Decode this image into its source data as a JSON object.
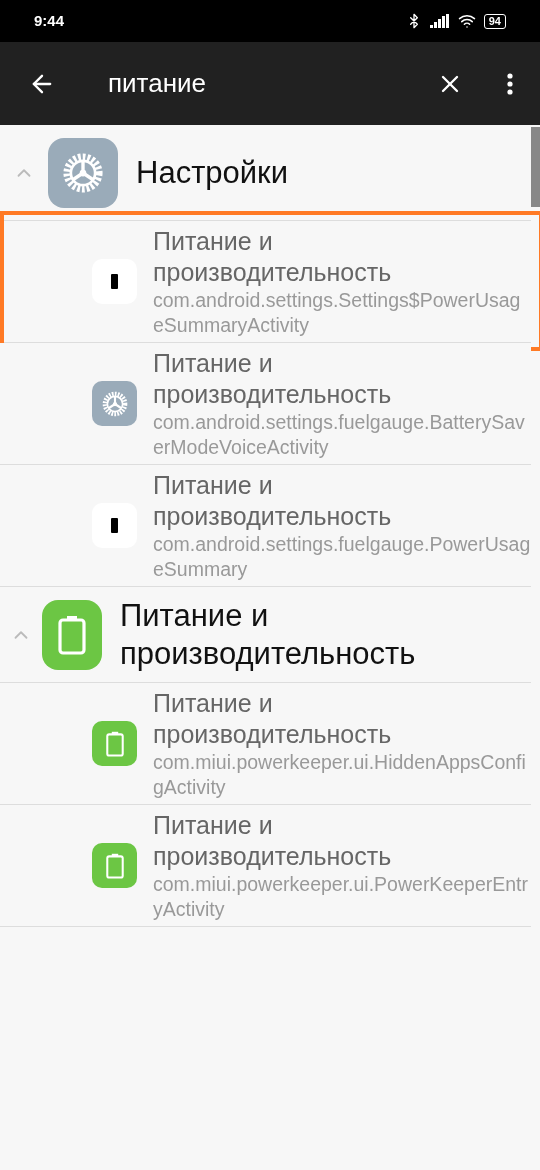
{
  "status_bar": {
    "time": "9:44",
    "battery": "94"
  },
  "toolbar": {
    "query": "питание"
  },
  "groups": [
    {
      "title": "Настройки",
      "kind": "gear",
      "expanded": true,
      "items": [
        {
          "title": "Питание и производительность",
          "subtitle": "com.android.settings.Settings$PowerUsageSummaryActivity",
          "kind": "battery-white",
          "highlighted": true
        },
        {
          "title": "Питание и производительность",
          "subtitle": "com.android.settings.fuelgauge.BatterySaverModeVoiceActivity",
          "kind": "gear",
          "highlighted": false
        },
        {
          "title": "Питание и производительность",
          "subtitle": "com.android.settings.fuelgauge.PowerUsageSummary",
          "kind": "battery-white",
          "highlighted": false
        }
      ]
    },
    {
      "title": "Питание и производительность",
      "kind": "battery-green",
      "expanded": true,
      "items": [
        {
          "title": "Питание и производительность",
          "subtitle": "com.miui.powerkeeper.ui.HiddenAppsConfigActivity",
          "kind": "battery-green",
          "highlighted": false
        },
        {
          "title": "Питание и производительность",
          "subtitle": "com.miui.powerkeeper.ui.PowerKeeperEntryActivity",
          "kind": "battery-green",
          "highlighted": false
        }
      ]
    }
  ]
}
